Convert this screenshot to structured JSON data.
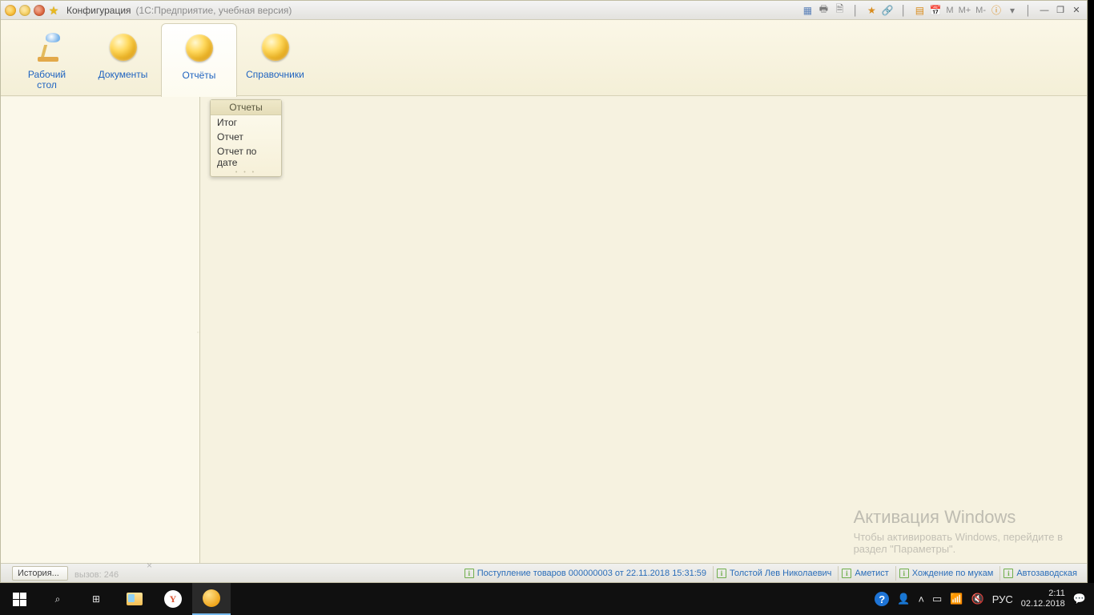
{
  "titlebar": {
    "title": "Конфигурация",
    "subtitle": "(1С:Предприятие, учебная версия)",
    "mem": {
      "m": "M",
      "mplus": "M+",
      "mminus": "M-"
    }
  },
  "sections": {
    "desktop": "Рабочий\nстол",
    "documents": "Документы",
    "reports": "Отчёты",
    "directories": "Справочники"
  },
  "menu": {
    "header": "Отчеты",
    "items": [
      "Итог",
      "Отчет",
      "Отчет по дате"
    ]
  },
  "watermark": {
    "title": "Активация Windows",
    "line1": "Чтобы активировать Windows, перейдите в",
    "line2": "раздел \"Параметры\"."
  },
  "appstatus": {
    "history": "История...",
    "ghost": "вызов: 246",
    "links": [
      "Поступление товаров 000000003 от 22.11.2018 15:31:59",
      "Толстой Лев Николаевич",
      "Аметист",
      "Хождение по мукам",
      "Автозаводская"
    ]
  },
  "taskbar": {
    "lang": "РУС",
    "time": "2:11",
    "date": "02.12.2018"
  }
}
